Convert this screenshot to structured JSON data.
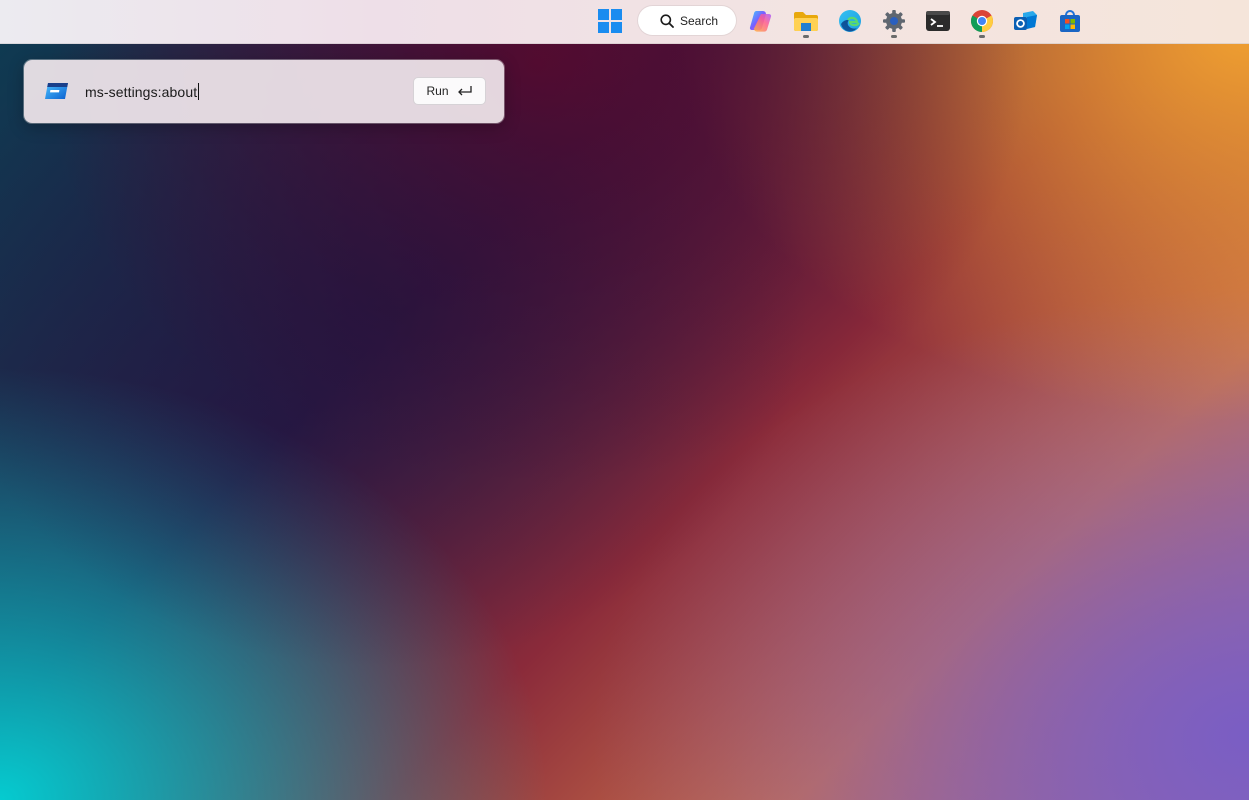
{
  "taskbar": {
    "search_label": "Search",
    "apps": [
      {
        "name": "start",
        "icon": "windows-logo-icon"
      },
      {
        "name": "copilot",
        "icon": "copilot-icon"
      },
      {
        "name": "file-explorer",
        "icon": "folder-icon",
        "running": true
      },
      {
        "name": "edge",
        "icon": "edge-icon"
      },
      {
        "name": "settings",
        "icon": "gear-icon",
        "running": true
      },
      {
        "name": "terminal",
        "icon": "terminal-icon"
      },
      {
        "name": "chrome",
        "icon": "chrome-icon",
        "running": true
      },
      {
        "name": "outlook",
        "icon": "outlook-icon"
      },
      {
        "name": "store",
        "icon": "store-icon"
      }
    ]
  },
  "run_dialog": {
    "input_value": "ms-settings:about",
    "button_label": "Run",
    "button_icon": "enter-arrow-icon"
  },
  "colors": {
    "accent": "#0078d4"
  }
}
